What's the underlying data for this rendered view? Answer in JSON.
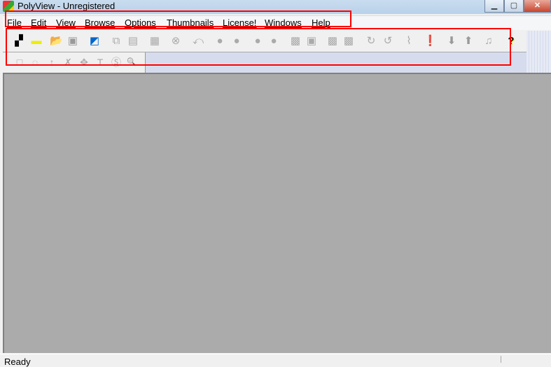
{
  "window": {
    "title": "PolyView - Unregistered",
    "minimize": "▁",
    "maximize": "▢",
    "close": "✕"
  },
  "menu": [
    "File",
    "Edit",
    "View",
    "Browse",
    "Options",
    "Thumbnails",
    "License!",
    "Windows",
    "Help"
  ],
  "toolbar1": [
    {
      "icon": "scan-icon",
      "glyph": "▞",
      "color": "#000"
    },
    {
      "icon": "new-folder-icon",
      "glyph": "▬",
      "color": "#ee0"
    },
    {
      "icon": "open-folder-icon",
      "glyph": "📂",
      "color": "#aa0"
    },
    {
      "icon": "save-icon",
      "glyph": "▣",
      "color": "#999"
    },
    {
      "icon": "image-icon",
      "glyph": "◩",
      "color": "#06c"
    },
    {
      "icon": "copy-icon",
      "glyph": "⧉",
      "color": "#aaa"
    },
    {
      "icon": "paste-icon",
      "glyph": "▤",
      "color": "#aaa"
    },
    {
      "icon": "print-icon",
      "glyph": "▦",
      "color": "#aaa"
    },
    {
      "icon": "delete-icon",
      "glyph": "⊗",
      "color": "#aaa"
    },
    {
      "icon": "undo-icon",
      "glyph": "⤺",
      "color": "#aaa"
    },
    {
      "icon": "circle-icon",
      "glyph": "●",
      "color": "#aaa"
    },
    {
      "icon": "circle-icon",
      "glyph": "●",
      "color": "#aaa"
    },
    {
      "icon": "circle-icon",
      "glyph": "●",
      "color": "#aaa"
    },
    {
      "icon": "circle-icon",
      "glyph": "●",
      "color": "#aaa"
    },
    {
      "icon": "pattern-square-icon",
      "glyph": "▩",
      "color": "#aaa"
    },
    {
      "icon": "square-icon",
      "glyph": "▣",
      "color": "#aaa"
    },
    {
      "icon": "pattern-square-icon",
      "glyph": "▩",
      "color": "#aaa"
    },
    {
      "icon": "pattern-square-icon",
      "glyph": "▩",
      "color": "#aaa"
    },
    {
      "icon": "rotate-right-icon",
      "glyph": "↻",
      "color": "#aaa"
    },
    {
      "icon": "rotate-left-icon",
      "glyph": "↺",
      "color": "#aaa"
    },
    {
      "icon": "waveform-icon",
      "glyph": "⌇",
      "color": "#aaa"
    },
    {
      "icon": "alert-icon",
      "glyph": "❗",
      "color": "#999"
    },
    {
      "icon": "arrow-down-icon",
      "glyph": "⬇",
      "color": "#999"
    },
    {
      "icon": "arrow-up-icon",
      "glyph": "⬆",
      "color": "#999"
    },
    {
      "icon": "music-icon",
      "glyph": "♫",
      "color": "#aaa"
    },
    {
      "icon": "help-icon",
      "glyph": "?",
      "color": "#000"
    }
  ],
  "toolbar2": [
    {
      "icon": "rectangle-select-icon",
      "glyph": "□"
    },
    {
      "icon": "lasso-icon",
      "glyph": "◌"
    },
    {
      "icon": "arrow-up-tool-icon",
      "glyph": "↑"
    },
    {
      "icon": "crop-icon",
      "glyph": "✗"
    },
    {
      "icon": "move-icon",
      "glyph": "✥"
    },
    {
      "icon": "text-icon",
      "glyph": "T"
    },
    {
      "icon": "stamp-icon",
      "glyph": "Ⓢ"
    },
    {
      "icon": "zoom-icon",
      "glyph": "🔍"
    }
  ],
  "status": {
    "text": "Ready"
  }
}
